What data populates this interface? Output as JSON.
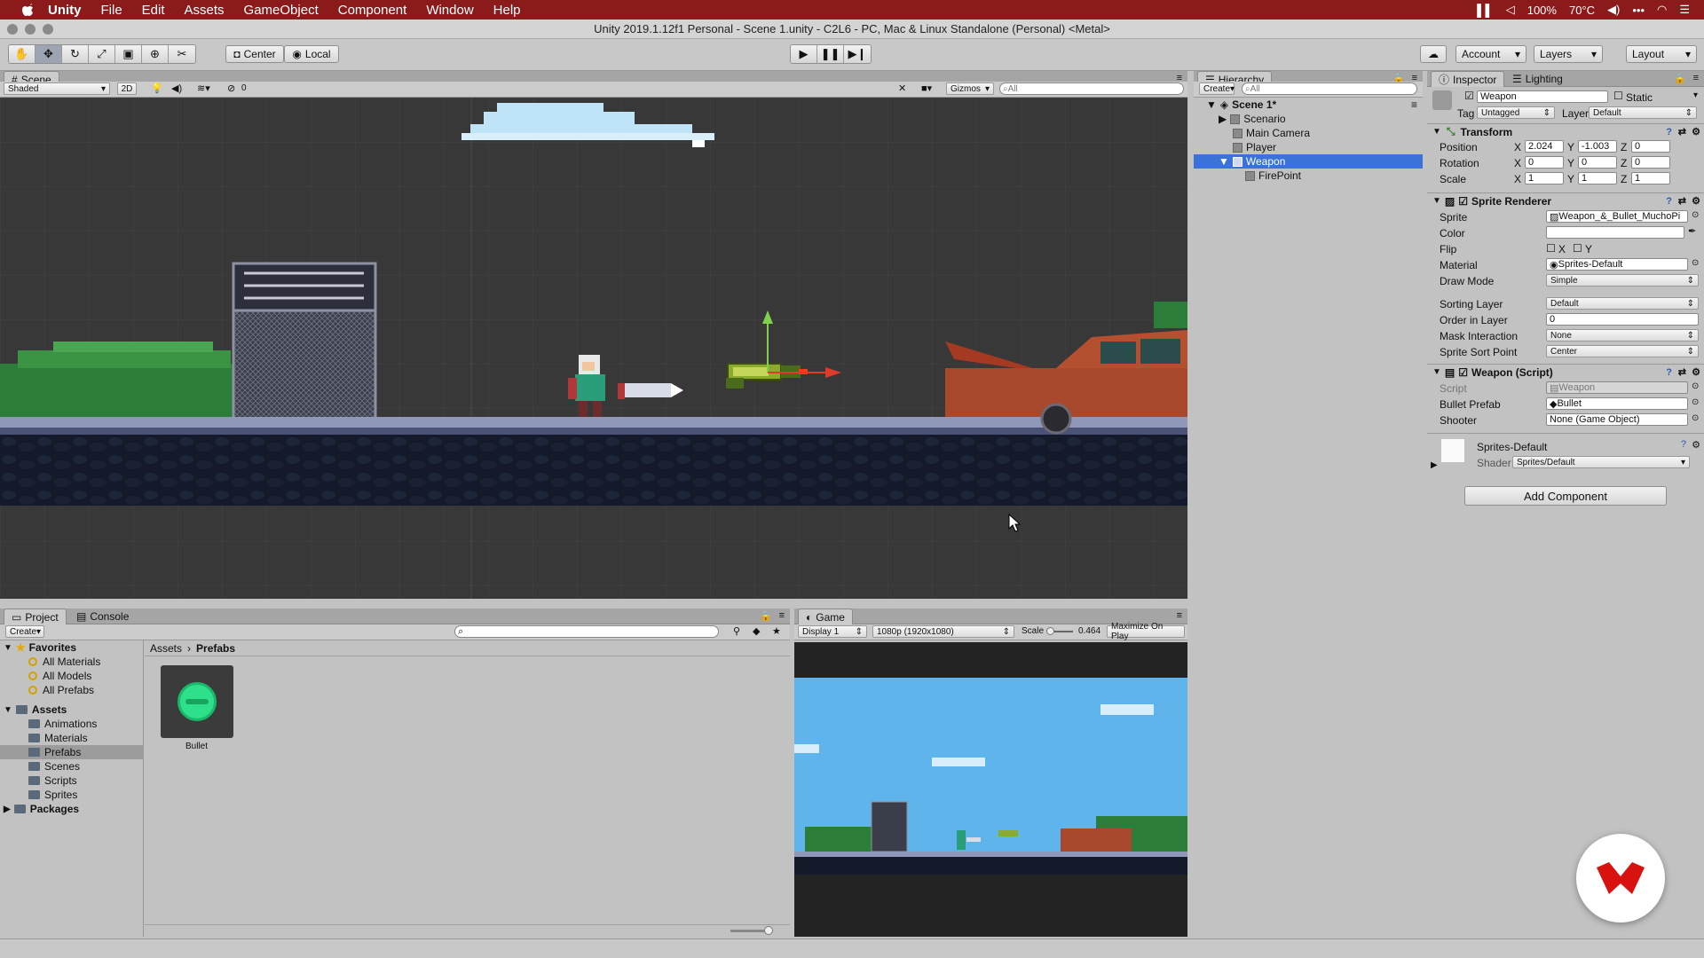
{
  "mac_menu": {
    "app": "Unity",
    "items": [
      "File",
      "Edit",
      "Assets",
      "GameObject",
      "Component",
      "Window",
      "Help"
    ],
    "status": {
      "battery": "100%",
      "temp": "70°C"
    }
  },
  "window_title": "Unity 2019.1.12f1 Personal - Scene 1.unity - C2L6 - PC, Mac & Linux Standalone (Personal) <Metal>",
  "toolbar": {
    "pivot": "Center",
    "space": "Local",
    "account": "Account",
    "layers": "Layers",
    "layout": "Layout"
  },
  "scene": {
    "tab": "Scene",
    "shading": "Shaded",
    "mode_2d": "2D",
    "fx_count": "0",
    "gizmos": "Gizmos",
    "search_placeholder": "All"
  },
  "hierarchy": {
    "tab": "Hierarchy",
    "create": "Create",
    "search_placeholder": "All",
    "scene_name": "Scene 1*",
    "items": [
      "Scenario",
      "Main Camera",
      "Player",
      "Weapon",
      "FirePoint"
    ]
  },
  "inspector": {
    "tab": "Inspector",
    "lighting_tab": "Lighting",
    "object_name": "Weapon",
    "static_label": "Static",
    "tag_label": "Tag",
    "tag_value": "Untagged",
    "layer_label": "Layer",
    "layer_value": "Default",
    "transform": {
      "title": "Transform",
      "position": {
        "label": "Position",
        "x": "2.024",
        "y": "-1.003",
        "z": "0"
      },
      "rotation": {
        "label": "Rotation",
        "x": "0",
        "y": "0",
        "z": "0"
      },
      "scale": {
        "label": "Scale",
        "x": "1",
        "y": "1",
        "z": "1"
      }
    },
    "sprite_renderer": {
      "title": "Sprite Renderer",
      "sprite_label": "Sprite",
      "sprite_value": "Weapon_&_Bullet_MuchoPi",
      "color_label": "Color",
      "flip_label": "Flip",
      "flip_x": "X",
      "flip_y": "Y",
      "material_label": "Material",
      "material_value": "Sprites-Default",
      "draw_mode_label": "Draw Mode",
      "draw_mode_value": "Simple",
      "sorting_layer_label": "Sorting Layer",
      "sorting_layer_value": "Default",
      "order_label": "Order in Layer",
      "order_value": "0",
      "mask_label": "Mask Interaction",
      "mask_value": "None",
      "sort_point_label": "Sprite Sort Point",
      "sort_point_value": "Center"
    },
    "weapon_script": {
      "title": "Weapon (Script)",
      "script_label": "Script",
      "script_value": "Weapon",
      "bullet_label": "Bullet Prefab",
      "bullet_value": "Bullet",
      "shooter_label": "Shooter",
      "shooter_value": "None (Game Object)"
    },
    "material_block": {
      "name": "Sprites-Default",
      "shader_label": "Shader",
      "shader_value": "Sprites/Default"
    },
    "add_component": "Add Component"
  },
  "project": {
    "tab": "Project",
    "console_tab": "Console",
    "create": "Create",
    "breadcrumb": [
      "Assets",
      "Prefabs"
    ],
    "favorites_label": "Favorites",
    "favorites": [
      "All Materials",
      "All Models",
      "All Prefabs"
    ],
    "assets_label": "Assets",
    "folders": [
      "Animations",
      "Materials",
      "Prefabs",
      "Scenes",
      "Scripts",
      "Sprites"
    ],
    "packages_label": "Packages",
    "asset_item": "Bullet"
  },
  "game": {
    "tab": "Game",
    "display": "Display 1",
    "resolution": "1080p (1920x1080)",
    "scale_label": "Scale",
    "scale_value": "0.464",
    "maximize": "Maximize On Play"
  },
  "colors": {
    "menubar": "#8b1a1a",
    "selection": "#3a72d8",
    "scene_bg": "#383838",
    "sky": "#5fb4ec",
    "bullet": "#2fe08a"
  }
}
